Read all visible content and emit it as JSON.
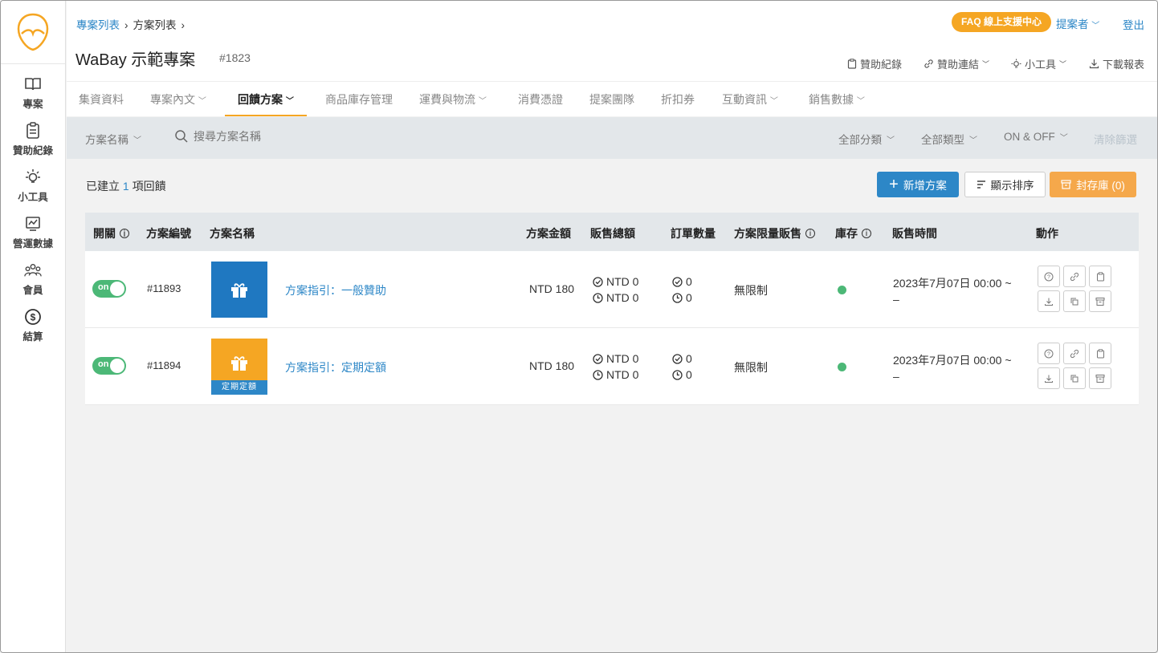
{
  "sidebar": {
    "items": [
      {
        "label": "專案",
        "icon": "book-icon"
      },
      {
        "label": "贊助紀錄",
        "icon": "clipboard-icon"
      },
      {
        "label": "小工具",
        "icon": "lightbulb-icon"
      },
      {
        "label": "營運數據",
        "icon": "chart-icon"
      },
      {
        "label": "會員",
        "icon": "users-icon"
      },
      {
        "label": "結算",
        "icon": "dollar-icon"
      }
    ]
  },
  "header": {
    "breadcrumb": {
      "first": "專案列表",
      "second": "方案列表"
    },
    "title": "WaBay 示範專案",
    "project_id": "#1823",
    "faq": "FAQ 線上支援中心",
    "user": "提案者",
    "logout": "登出",
    "actions": {
      "record": "贊助紀錄",
      "link": "贊助連結",
      "tools": "小工具",
      "download": "下載報表"
    }
  },
  "tabs": [
    {
      "label": "集資資料"
    },
    {
      "label": "專案內文"
    },
    {
      "label": "回饋方案"
    },
    {
      "label": "商品庫存管理"
    },
    {
      "label": "運費與物流"
    },
    {
      "label": "消費憑證"
    },
    {
      "label": "提案團隊"
    },
    {
      "label": "折扣券"
    },
    {
      "label": "互動資訊"
    },
    {
      "label": "銷售數據"
    }
  ],
  "filter": {
    "field": "方案名稱",
    "search_placeholder": "搜尋方案名稱",
    "category": "全部分類",
    "type": "全部類型",
    "status": "ON & OFF",
    "clear": "清除篩選"
  },
  "summary": {
    "prefix": "已建立",
    "count": "1",
    "suffix": "項回饋"
  },
  "buttons": {
    "new": "新增方案",
    "sort": "顯示排序",
    "archive": "封存庫 (0)"
  },
  "table": {
    "headers": {
      "toggle": "開關",
      "id": "方案編號",
      "name": "方案名稱",
      "price": "方案金額",
      "sales": "販售總額",
      "orders": "訂單數量",
      "limit": "方案限量販售",
      "stock": "庫存",
      "time": "販售時間",
      "actions": "動作"
    },
    "rows": [
      {
        "toggle": "on",
        "id": "#11893",
        "name": "方案指引：一般贊助",
        "thumb_color": "#1f78c1",
        "tag": "",
        "price": "NTD 180",
        "sales_done": "NTD 0",
        "sales_pending": "NTD 0",
        "orders_done": "0",
        "orders_pending": "0",
        "limit": "無限制",
        "time_line1": "2023年7月07日 00:00 ~",
        "time_line2": "–"
      },
      {
        "toggle": "on",
        "id": "#11894",
        "name": "方案指引：定期定額",
        "thumb_color": "#f5a623",
        "tag": "定期定額",
        "price": "NTD 180",
        "sales_done": "NTD 0",
        "sales_pending": "NTD 0",
        "orders_done": "0",
        "orders_pending": "0",
        "limit": "無限制",
        "time_line1": "2023年7月07日 00:00 ~",
        "time_line2": "–"
      }
    ]
  },
  "colors": {
    "accent": "#f5a623",
    "link": "#2d87c7",
    "success": "#4cb877"
  }
}
